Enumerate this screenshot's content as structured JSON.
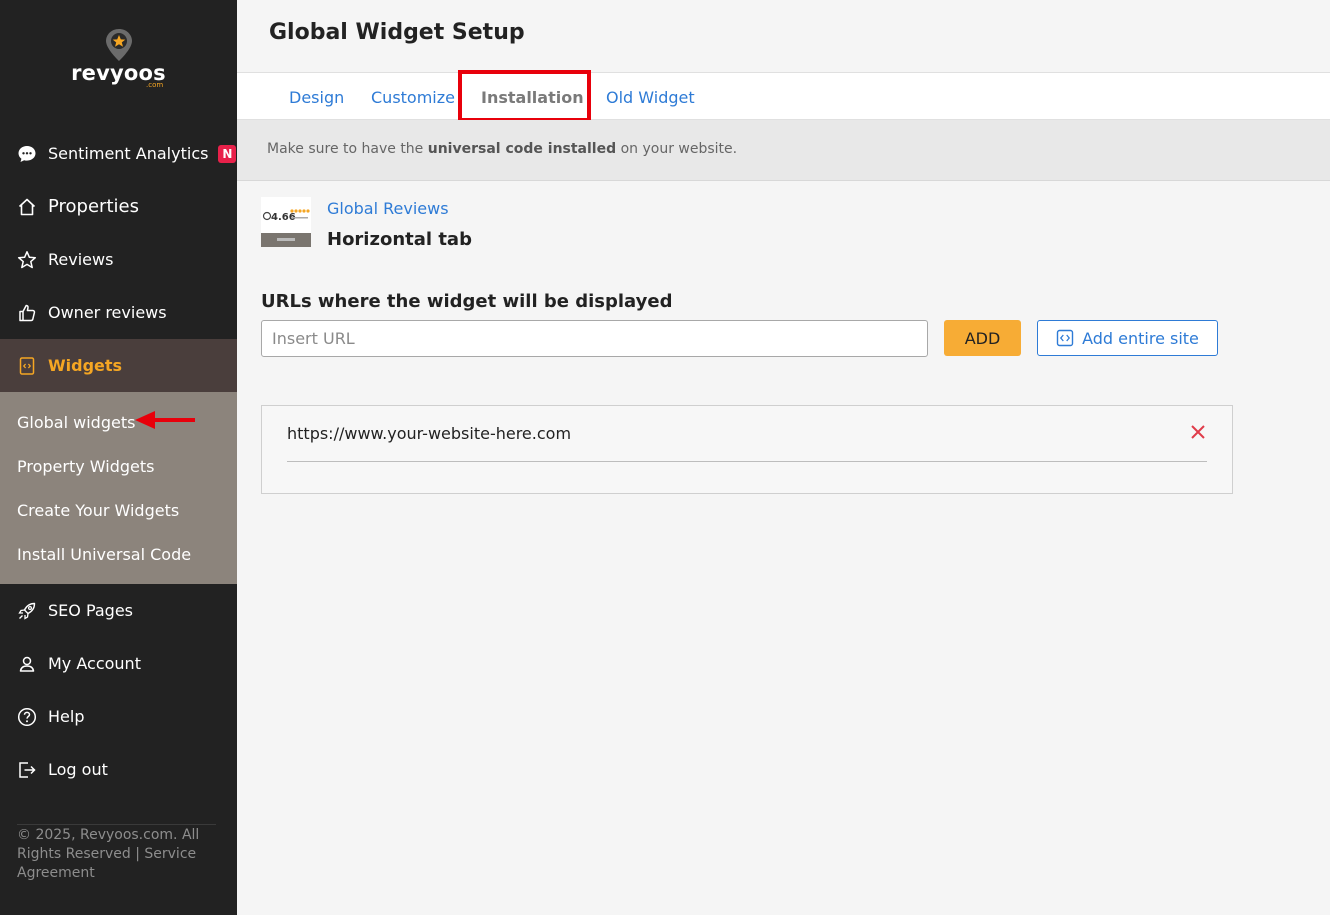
{
  "brand": {
    "name": "revyoos",
    "domain": ".com",
    "accent": "#f5a623"
  },
  "sidebar": {
    "items": [
      {
        "label": "Sentiment Analytics",
        "icon": "chat-bubble-icon",
        "badge": "N"
      },
      {
        "label": "Properties",
        "icon": "home-icon"
      },
      {
        "label": "Reviews",
        "icon": "star-icon"
      },
      {
        "label": "Owner reviews",
        "icon": "thumbs-up-icon"
      },
      {
        "label": "Widgets",
        "icon": "code-file-icon",
        "active": true
      },
      {
        "label": "SEO Pages",
        "icon": "rocket-icon"
      },
      {
        "label": "My Account",
        "icon": "user-icon"
      },
      {
        "label": "Help",
        "icon": "help-circle-icon"
      },
      {
        "label": "Log out",
        "icon": "logout-icon"
      }
    ],
    "subitems": [
      {
        "label": "Global widgets",
        "active": true
      },
      {
        "label": "Property Widgets"
      },
      {
        "label": "Create Your Widgets"
      },
      {
        "label": "Install Universal Code"
      }
    ],
    "footer": "© 2025, Revyoos.com. All Rights Reserved | Service Agreement"
  },
  "header": {
    "title": "Global Widget Setup"
  },
  "tabs": [
    {
      "label": "Design"
    },
    {
      "label": "Customize"
    },
    {
      "label": "Installation",
      "active": true
    },
    {
      "label": "Old Widget"
    }
  ],
  "notice": {
    "prefix": "Make sure to have the ",
    "bold": "universal code installed",
    "suffix": " on your website."
  },
  "widget": {
    "link": "Global Reviews",
    "name": "Horizontal tab",
    "thumb_score": "4.66"
  },
  "urls": {
    "label": "URLs where the widget will be displayed",
    "input_placeholder": "Insert URL",
    "add_label": "ADD",
    "add_site_label": "Add entire site",
    "list": [
      "https://www.your-website-here.com"
    ]
  },
  "colors": {
    "link": "#2e7bd6",
    "add_button": "#f7ac35",
    "highlight": "#e8000b",
    "badge": "#e8214a"
  }
}
